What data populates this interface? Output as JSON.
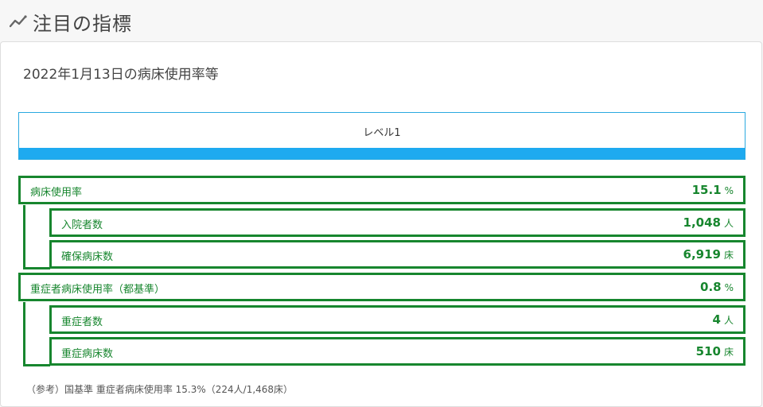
{
  "header": {
    "title": "注目の指標",
    "icon": "trend-line-icon"
  },
  "card": {
    "subtitle": "2022年1月13日の病床使用率等",
    "level": {
      "label": "レベル1",
      "bar_color": "#1eaaf0"
    },
    "groups": [
      {
        "label": "病床使用率",
        "value": "15.1",
        "unit": "%",
        "children": [
          {
            "label": "入院者数",
            "value": "1,048",
            "unit": "人"
          },
          {
            "label": "確保病床数",
            "value": "6,919",
            "unit": "床"
          }
        ]
      },
      {
        "label": "重症者病床使用率（都基準）",
        "value": "0.8",
        "unit": "%",
        "children": [
          {
            "label": "重症者数",
            "value": "4",
            "unit": "人"
          },
          {
            "label": "重症病床数",
            "value": "510",
            "unit": "床"
          }
        ]
      }
    ],
    "footnote": "（参考）国基準 重症者病床使用率 15.3%（224人/1,468床）"
  },
  "colors": {
    "accent_green": "#17862e",
    "level_blue": "#1eaaf0"
  }
}
